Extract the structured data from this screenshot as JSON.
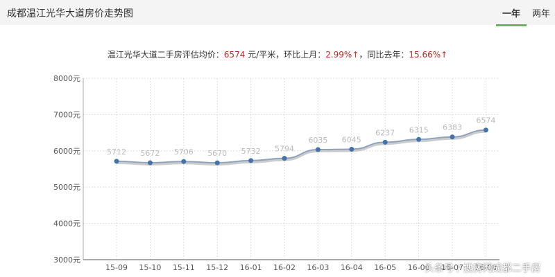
{
  "header": {
    "title": "成都温江光华大道房价走势图",
    "tabs": [
      "一年",
      "两年"
    ]
  },
  "summary": {
    "label": "温江光华大道二手房评估均价：",
    "price": "6574",
    "unit": " 元/平米，环比上月：",
    "mom": "2.99%↑",
    "sep": "，同比去年：",
    "yoy": "15.66%↑"
  },
  "watermark": "头条号 / 搜房网成都二手房",
  "colors": {
    "line": "#8fa3bf",
    "point": "#4572a7",
    "accent": "#6db35c"
  },
  "chart_data": {
    "type": "line",
    "categories": [
      "15-09",
      "15-10",
      "15-11",
      "15-12",
      "16-01",
      "16-02",
      "16-03",
      "16-04",
      "16-05",
      "16-06",
      "16-07",
      "16-08"
    ],
    "values": [
      5712,
      5672,
      5706,
      5670,
      5732,
      5794,
      6035,
      6045,
      6237,
      6315,
      6383,
      6574
    ],
    "yticks": [
      "3000元",
      "4000元",
      "5000元",
      "6000元",
      "7000元",
      "8000元"
    ],
    "ylim": [
      3000,
      8000
    ],
    "grid": true
  }
}
